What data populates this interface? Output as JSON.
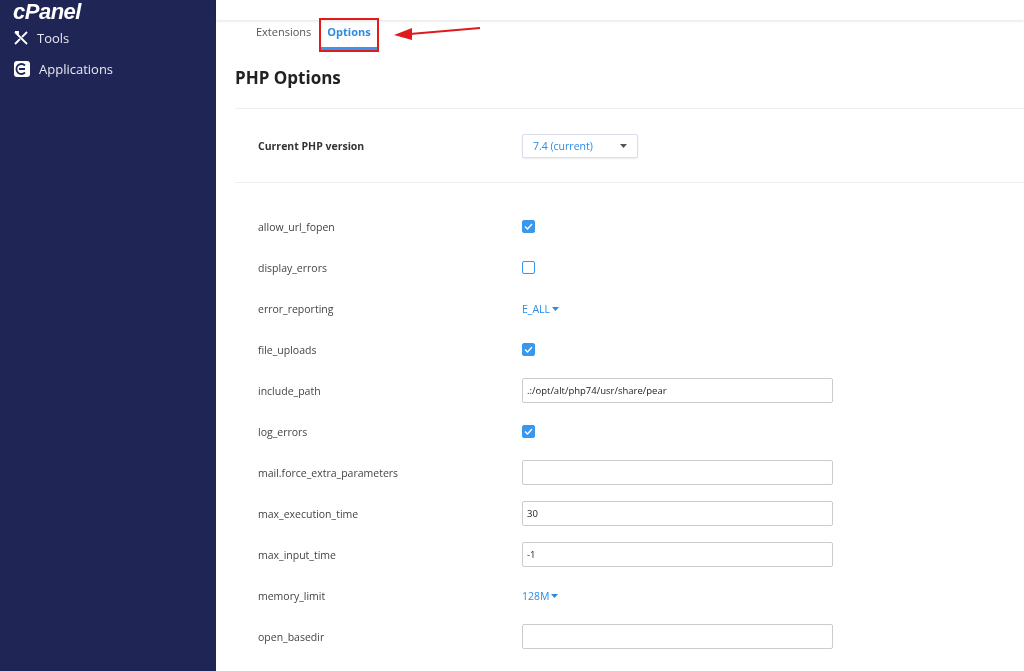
{
  "sidebar": {
    "logo": "cPanel",
    "items": [
      {
        "label": "Tools"
      },
      {
        "label": "Applications"
      }
    ]
  },
  "tabs": [
    {
      "label": "Extensions",
      "selected": false
    },
    {
      "label": "Options",
      "selected": true
    }
  ],
  "heading": "PHP Options",
  "version": {
    "label": "Current PHP version",
    "value": "7.4 (current)"
  },
  "options": [
    {
      "name": "allow_url_fopen",
      "kind": "checkbox",
      "checked": true
    },
    {
      "name": "display_errors",
      "kind": "checkbox",
      "checked": false
    },
    {
      "name": "error_reporting",
      "kind": "dropdown",
      "value": "E_ALL"
    },
    {
      "name": "file_uploads",
      "kind": "checkbox",
      "checked": true
    },
    {
      "name": "include_path",
      "kind": "text",
      "value": ".:/opt/alt/php74/usr/share/pear"
    },
    {
      "name": "log_errors",
      "kind": "checkbox",
      "checked": true
    },
    {
      "name": "mail.force_extra_parameters",
      "kind": "text"
    },
    {
      "name": "max_execution_time",
      "kind": "text",
      "value": "30"
    },
    {
      "name": "max_input_time",
      "kind": "text",
      "value": "-1"
    },
    {
      "name": "memory_limit",
      "kind": "dropdown",
      "value": "128M"
    },
    {
      "name": "open_basedir",
      "kind": "text"
    }
  ]
}
